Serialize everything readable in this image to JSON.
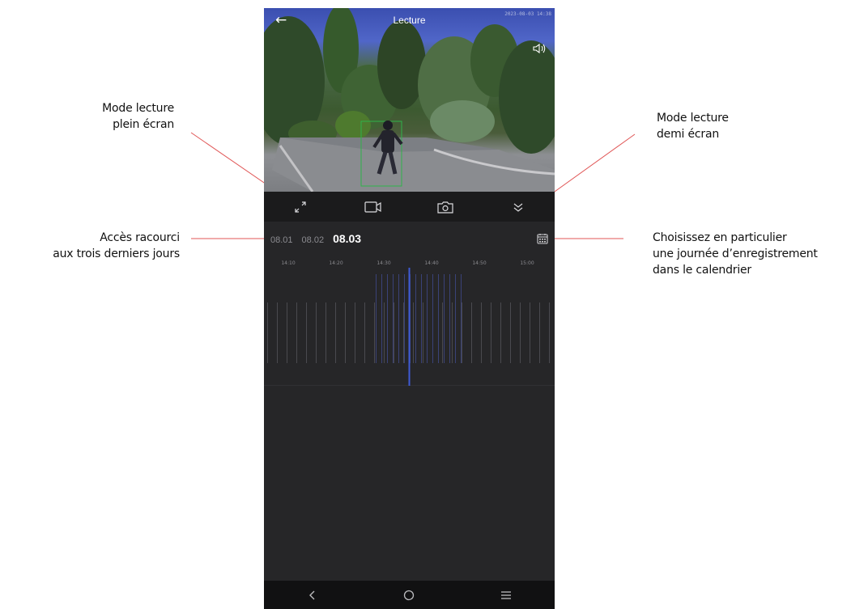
{
  "annotations": {
    "fullscreen": [
      "Mode lecture",
      "plein écran"
    ],
    "halfscreen": [
      "Mode lecture",
      "demi écran"
    ],
    "recent_days": [
      "Accès racourci",
      "aux trois derniers jours"
    ],
    "calendar": [
      "Choisissez en particulier",
      "une journée d’enregistrement",
      "dans le calendrier"
    ]
  },
  "player": {
    "title": "Lecture",
    "timestamp": "2023-08-03 14:38"
  },
  "controls": [
    "fullscreen-expand-icon",
    "video-record-icon",
    "camera-snapshot-icon",
    "chevron-double-down-icon"
  ],
  "days": [
    "08.01",
    "08.02",
    "08.03"
  ],
  "active_day": "08.03",
  "timeline": {
    "tick_labels": [
      "14:10",
      "14:20",
      "14:30",
      "14:40",
      "14:50",
      "15:00"
    ]
  },
  "colors": {
    "accent": "#3e5bd6",
    "background": "#262628",
    "leader_line": "#e05555"
  }
}
